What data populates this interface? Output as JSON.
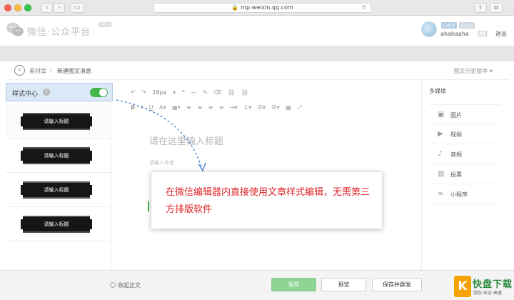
{
  "browser": {
    "address": "mp.weixin.qq.com"
  },
  "header": {
    "logo_text": "微信·公众平台",
    "beta": "Beta",
    "tag_1": "订阅号",
    "tag_2": "未认证",
    "username": "ahahaaha",
    "logout": "退出"
  },
  "breadcrumb": {
    "library": "素材库",
    "separator": "/",
    "current": "新建图文消息",
    "history": "图文历史版本 ▾"
  },
  "style_center": {
    "title": "样式中心",
    "help": "?",
    "toggle_on": true,
    "templates": [
      {
        "label": "请输入标题"
      },
      {
        "label": "请输入标题"
      },
      {
        "label": "请输入标题"
      },
      {
        "label": "请输入标题"
      }
    ]
  },
  "editor": {
    "font_size": "16px",
    "title_placeholder": "请在这里输入标题",
    "author_placeholder": "请输入作者"
  },
  "media": {
    "title": "多媒体",
    "items": [
      {
        "label": "图片",
        "icon": "image-icon"
      },
      {
        "label": "视频",
        "icon": "video-icon"
      },
      {
        "label": "音频",
        "icon": "audio-icon"
      },
      {
        "label": "投票",
        "icon": "poll-icon"
      },
      {
        "label": "小程序",
        "icon": "miniprogram-icon"
      }
    ]
  },
  "callout": {
    "text": "在微信编辑器内直接使用文章样式编辑，无需第三方排版软件"
  },
  "footer": {
    "collapse": "收起正文",
    "save": "保存",
    "preview": "预览",
    "save_and_send": "保存并群发"
  },
  "watermark": {
    "mark": "K",
    "main": "快盘下载",
    "sub": "绿色·安全·高速"
  },
  "colors": {
    "accent_green": "#44b549",
    "callout_red": "#e0262a",
    "selection_blue": "#dbe8f7"
  }
}
